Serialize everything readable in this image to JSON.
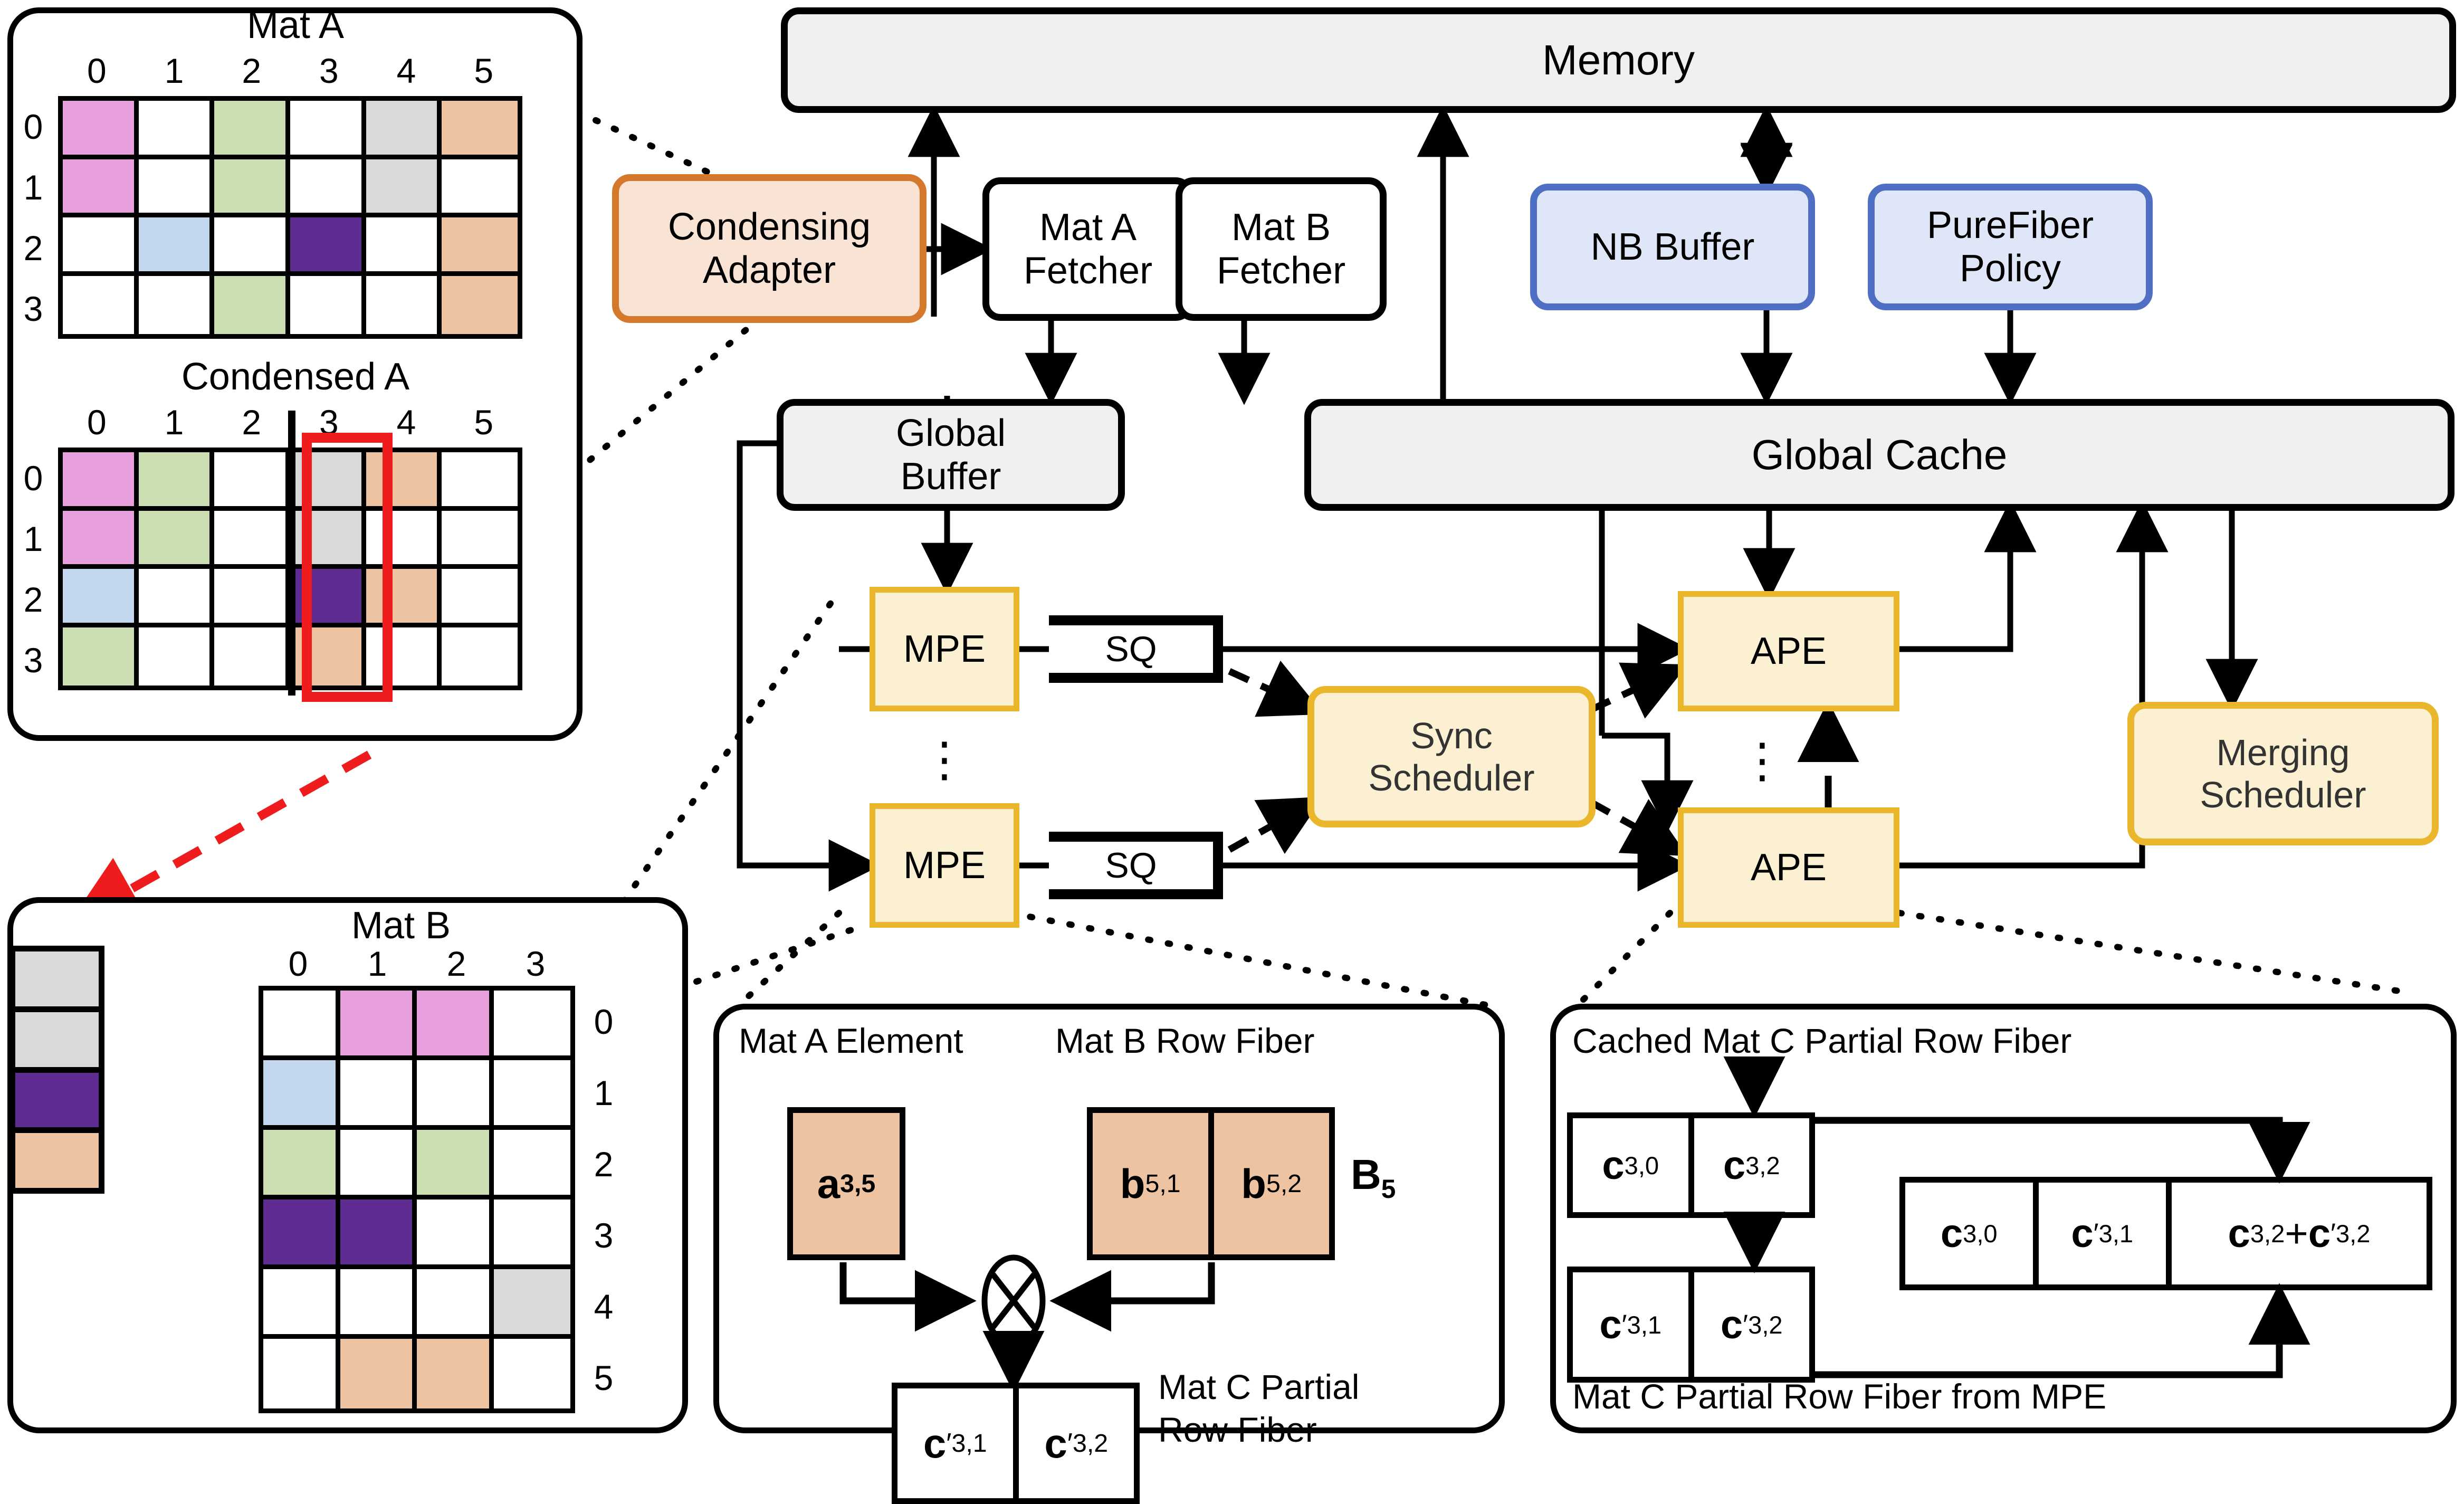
{
  "palette": {
    "pink": "#e79fdd",
    "green": "#ccdfb3",
    "blue": "#c3d7ef",
    "grey": "#d9d9d9",
    "peach": "#edc3a1",
    "purple": "#5f2d91",
    "white": "#ffffff",
    "grey_block_fill": "#f0f0f0",
    "grey_block_border": "#000000",
    "orange_fill": "#f8e3d4",
    "orange_border": "#d4782c",
    "blue_fill": "#dfe6f7",
    "blue_border": "#4f6fc4",
    "yellow_fill": "#fbf0d1",
    "yellow_border": "#eab62c",
    "red": "#ee1c1c",
    "black": "#000000"
  },
  "left_panel": {
    "mat_a": {
      "title": "Mat A",
      "col_headers": [
        "0",
        "1",
        "2",
        "3",
        "4",
        "5"
      ],
      "row_headers": [
        "0",
        "1",
        "2",
        "3"
      ],
      "cells": [
        [
          "pink",
          "white",
          "green",
          "white",
          "grey",
          "peach"
        ],
        [
          "pink",
          "white",
          "green",
          "white",
          "grey",
          "white"
        ],
        [
          "white",
          "blue",
          "white",
          "purple",
          "white",
          "peach"
        ],
        [
          "white",
          "white",
          "green",
          "white",
          "white",
          "peach"
        ]
      ]
    },
    "condensed_a": {
      "title": "Condensed A",
      "col_headers": [
        "0",
        "1",
        "2",
        "3",
        "4",
        "5"
      ],
      "row_headers": [
        "0",
        "1",
        "2",
        "3"
      ],
      "cells": [
        [
          "pink",
          "green",
          "white",
          "grey",
          "peach",
          "white"
        ],
        [
          "pink",
          "green",
          "white",
          "grey",
          "white",
          "white"
        ],
        [
          "blue",
          "white",
          "white",
          "purple",
          "peach",
          "white"
        ],
        [
          "green",
          "white",
          "white",
          "peach",
          "white",
          "white"
        ]
      ],
      "highlight_column_index": 3,
      "divider_after_column_index": 2
    }
  },
  "mat_b_panel": {
    "title": "Mat B",
    "col_headers": [
      "0",
      "1",
      "2",
      "3"
    ],
    "row_headers": [
      "0",
      "1",
      "2",
      "3",
      "4",
      "5"
    ],
    "fiber_column": [
      "grey",
      "grey",
      "purple",
      "peach"
    ],
    "cells": [
      [
        "white",
        "pink",
        "pink",
        "white"
      ],
      [
        "blue",
        "white",
        "white",
        "white"
      ],
      [
        "green",
        "white",
        "green",
        "white"
      ],
      [
        "purple",
        "purple",
        "white",
        "white"
      ],
      [
        "white",
        "white",
        "white",
        "grey"
      ],
      [
        "white",
        "peach",
        "peach",
        "white"
      ]
    ]
  },
  "arch": {
    "memory": "Memory",
    "global_cache": "Global Cache",
    "global_buffer": "Global\nBuffer",
    "condensing_adapter": "Condensing\nAdapter",
    "mat_a_fetcher": "Mat A\nFetcher",
    "mat_b_fetcher": "Mat B\nFetcher",
    "nb_buffer": "NB Buffer",
    "purefiber_policy": "PureFiber\nPolicy",
    "mpe_top": "MPE",
    "mpe_bottom": "MPE",
    "sq_top": "SQ",
    "sq_bottom": "SQ",
    "ape_top": "APE",
    "ape_bottom": "APE",
    "sync_scheduler": "Sync\nScheduler",
    "merging_scheduler": "Merging\nScheduler",
    "vertical_ellipsis": "⋮"
  },
  "mpe_detail": {
    "label_mat_a_element": "Mat A Element",
    "label_mat_b_row_fiber": "Mat B Row Fiber",
    "label_mat_c_partial": "Mat C Partial\nRow Fiber",
    "a_cell": {
      "base": "a",
      "sub": "3,5"
    },
    "b_cells": [
      {
        "base": "b",
        "sub": "5,1"
      },
      {
        "base": "b",
        "sub": "5,2"
      }
    ],
    "b_fiber_name": {
      "base": "B",
      "sub": "5"
    },
    "c_cells": [
      {
        "base": "c",
        "prime": true,
        "sub": "3,1"
      },
      {
        "base": "c",
        "prime": true,
        "sub": "3,2"
      }
    ],
    "operator": "⊗"
  },
  "ape_detail": {
    "label_cached": "Cached Mat C Partial Row Fiber",
    "label_from_mpe": "Mat C Partial Row Fiber from MPE",
    "cached_cells": [
      {
        "base": "c",
        "prime": false,
        "sub": "3,0"
      },
      {
        "base": "c",
        "prime": false,
        "sub": "3,2"
      }
    ],
    "mpe_cells": [
      {
        "base": "c",
        "prime": true,
        "sub": "3,1"
      },
      {
        "base": "c",
        "prime": true,
        "sub": "3,2"
      }
    ],
    "result_cells": [
      {
        "text": "c",
        "sub": "3,0",
        "prime": false
      },
      {
        "text": "c",
        "sub": "3,1",
        "prime": true
      },
      {
        "text": "c",
        "sub": "3,2",
        "prime": false,
        "plus": true,
        "text2": "c",
        "sub2": "3,2",
        "prime2": true
      }
    ]
  }
}
